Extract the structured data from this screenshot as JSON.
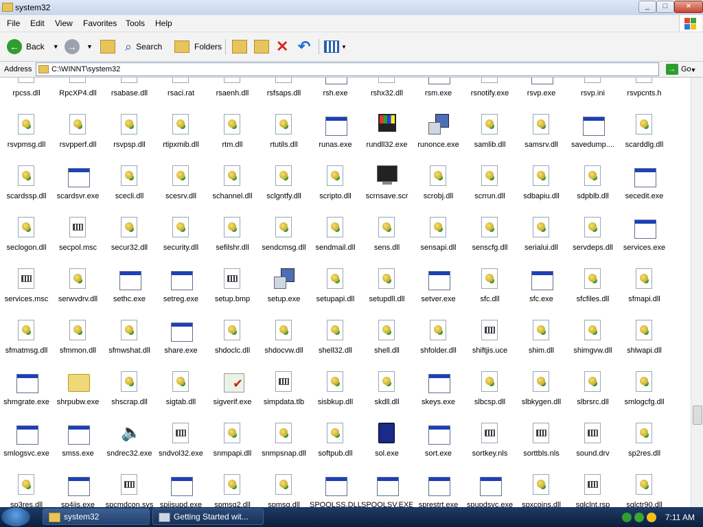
{
  "window": {
    "title": "system32"
  },
  "menubar": [
    "File",
    "Edit",
    "View",
    "Favorites",
    "Tools",
    "Help"
  ],
  "toolbar": {
    "back": "Back",
    "search": "Search",
    "folders": "Folders"
  },
  "address": {
    "label": "Address",
    "value": "C:\\WINNT\\system32",
    "go": "Go"
  },
  "icon_types": {
    "dll": "dll-file-icon",
    "exe": "application-window-icon",
    "txt": "text-document-icon",
    "ms": "windows-logo-icon",
    "monitor": "screensaver-monitor-icon",
    "setup": "setup-computer-icon",
    "folder": "shared-folder-icon",
    "check": "verify-checkmark-icon",
    "speaker": "speaker-icon",
    "card": "card-game-icon"
  },
  "files": [
    [
      "rpcss.dll",
      "RpcXP4.dll",
      "rsabase.dll",
      "rsaci.rat",
      "rsaenh.dll",
      "rsfsaps.dll",
      "rsh.exe",
      "rshx32.dll",
      "rsm.exe",
      "rsnotify.exe",
      "rsvp.exe",
      "rsvp.ini",
      "rsvpcnts.h"
    ],
    [
      "rsvpmsg.dll",
      "rsvpperf.dll",
      "rsvpsp.dll",
      "rtipxmib.dll",
      "rtm.dll",
      "rtutils.dll",
      "runas.exe",
      "rundll32.exe",
      "runonce.exe",
      "samlib.dll",
      "samsrv.dll",
      "savedump....",
      "scarddlg.dll"
    ],
    [
      "scardssp.dll",
      "scardsvr.exe",
      "scecli.dll",
      "scesrv.dll",
      "schannel.dll",
      "sclgntfy.dll",
      "scripto.dll",
      "scrnsave.scr",
      "scrobj.dll",
      "scrrun.dll",
      "sdbapiu.dll",
      "sdpblb.dll",
      "secedit.exe"
    ],
    [
      "seclogon.dll",
      "secpol.msc",
      "secur32.dll",
      "security.dll",
      "sefilshr.dll",
      "sendcmsg.dll",
      "sendmail.dll",
      "sens.dll",
      "sensapi.dll",
      "senscfg.dll",
      "serialui.dll",
      "servdeps.dll",
      "services.exe"
    ],
    [
      "services.msc",
      "serwvdrv.dll",
      "sethc.exe",
      "setreg.exe",
      "setup.bmp",
      "setup.exe",
      "setupapi.dll",
      "setupdll.dll",
      "setver.exe",
      "sfc.dll",
      "sfc.exe",
      "sfcfiles.dll",
      "sfmapi.dll"
    ],
    [
      "sfmatmsg.dll",
      "sfmmon.dll",
      "sfmwshat.dll",
      "share.exe",
      "shdoclc.dll",
      "shdocvw.dll",
      "shell32.dll",
      "shell.dll",
      "shfolder.dll",
      "shiftjis.uce",
      "shim.dll",
      "shimgvw.dll",
      "shlwapi.dll"
    ],
    [
      "shmgrate.exe",
      "shrpubw.exe",
      "shscrap.dll",
      "sigtab.dll",
      "sigverif.exe",
      "simpdata.tlb",
      "sisbkup.dll",
      "skdll.dll",
      "skeys.exe",
      "slbcsp.dll",
      "slbkygen.dll",
      "slbrsrc.dll",
      "smlogcfg.dll"
    ],
    [
      "smlogsvc.exe",
      "smss.exe",
      "sndrec32.exe",
      "sndvol32.exe",
      "snmpapi.dll",
      "snmpsnap.dll",
      "softpub.dll",
      "sol.exe",
      "sort.exe",
      "sortkey.nls",
      "sorttbls.nls",
      "sound.drv",
      "sp2res.dll"
    ],
    [
      "sp3res.dll",
      "sp4iis.exe",
      "spcmdcon.sys",
      "spiisupd.exe",
      "spmsg2.dll",
      "spmsg.dll",
      "SPOOLSS.DLL",
      "SPOOLSV.EXE",
      "sprestrt.exe",
      "spupdsvc.exe",
      "spxcoins.dll",
      "sqlclnt.rsp",
      "sqlctr90.dll"
    ]
  ],
  "file_icons": [
    [
      "dll",
      "dll",
      "dll",
      "txt",
      "dll",
      "dll",
      "exe",
      "dll",
      "exe",
      "dll",
      "exe",
      "txt",
      "txt"
    ],
    [
      "dll",
      "dll",
      "dll",
      "dll",
      "dll",
      "dll",
      "exe",
      "ms",
      "setup",
      "dll",
      "dll",
      "exe",
      "dll"
    ],
    [
      "dll",
      "exe",
      "dll",
      "dll",
      "dll",
      "dll",
      "dll",
      "monitor",
      "dll",
      "dll",
      "dll",
      "dll",
      "exe"
    ],
    [
      "dll",
      "txt",
      "dll",
      "dll",
      "dll",
      "dll",
      "dll",
      "dll",
      "dll",
      "dll",
      "dll",
      "dll",
      "exe"
    ],
    [
      "txt",
      "dll",
      "exe",
      "exe",
      "txt",
      "setup",
      "dll",
      "dll",
      "exe",
      "dll",
      "exe",
      "dll",
      "dll"
    ],
    [
      "dll",
      "dll",
      "dll",
      "exe",
      "dll",
      "dll",
      "dll",
      "dll",
      "dll",
      "txt",
      "dll",
      "dll",
      "dll"
    ],
    [
      "exe",
      "folder",
      "dll",
      "dll",
      "check",
      "txt",
      "dll",
      "dll",
      "exe",
      "dll",
      "dll",
      "dll",
      "dll"
    ],
    [
      "exe",
      "exe",
      "speaker",
      "txt",
      "dll",
      "dll",
      "dll",
      "card",
      "exe",
      "txt",
      "txt",
      "txt",
      "dll"
    ],
    [
      "dll",
      "exe",
      "txt",
      "exe",
      "dll",
      "dll",
      "exe",
      "exe",
      "exe",
      "exe",
      "dll",
      "txt",
      "dll"
    ]
  ],
  "taskbar": {
    "tasks": [
      "system32",
      "Getting Started wit..."
    ],
    "clock": "7:11 AM"
  }
}
